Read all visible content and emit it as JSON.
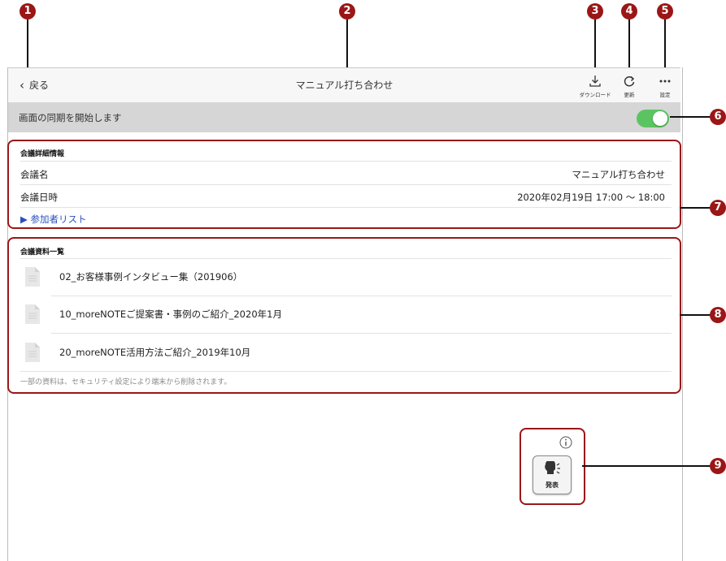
{
  "markers": [
    "1",
    "2",
    "3",
    "4",
    "5",
    "6",
    "7",
    "8",
    "9"
  ],
  "nav": {
    "back_label": "戻る",
    "title": "マニュアル打ち合わせ",
    "download_label": "ダウンロード",
    "refresh_label": "更新",
    "settings_label": "設定"
  },
  "sync": {
    "label": "画面の同期を開始します",
    "enabled": true
  },
  "details": {
    "heading": "会議詳細情報",
    "name_label": "会議名",
    "name_value": "マニュアル打ち合わせ",
    "datetime_label": "会議日時",
    "datetime_value": "2020年02月19日 17:00 ～ 18:00",
    "participants_link": "▶ 参加者リスト"
  },
  "materials": {
    "heading": "会議資料一覧",
    "items": [
      {
        "name": "02_お客様事例インタビュー集（201906）"
      },
      {
        "name": "10_moreNOTEご提案書・事例のご紹介_2020年1月"
      },
      {
        "name": "20_moreNOTE活用方法ご紹介_2019年10月"
      }
    ],
    "note": "一部の資料は、セキュリティ設定により端末から削除されます。"
  },
  "present": {
    "label": "発表",
    "icon": "speaker-icon",
    "info_icon": "info-icon"
  },
  "colors": {
    "callout": "#9b1616",
    "toggle_on": "#5ac560",
    "link": "#2a4fbf",
    "syncbar": "#d6d6d6"
  }
}
